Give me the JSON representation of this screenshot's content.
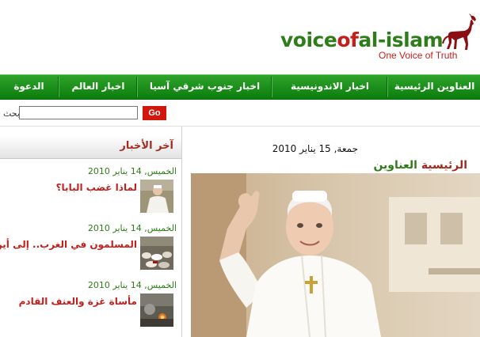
{
  "header": {
    "logo": {
      "part1": "voice",
      "part2": "of",
      "part3": "al-islam"
    },
    "tagline": "One Voice of Truth",
    "logo_icon": "horse-icon"
  },
  "nav": {
    "items": [
      {
        "label": "العناوين الرئيسية"
      },
      {
        "label": "اخبار الاندونيسية"
      },
      {
        "label": "اخبار جنوب شرقي آسيا"
      },
      {
        "label": "اخبار العالم"
      },
      {
        "label": "الدعوة"
      }
    ]
  },
  "search": {
    "label": "بحث",
    "placeholder": "",
    "value": "",
    "button": "Go"
  },
  "sidebar": {
    "title": "آخر الأخبار",
    "items": [
      {
        "date": "الخميس, 14 يناير 2010",
        "title": "لماذا غضب البابا؟",
        "thumb": "pope-thumbnail"
      },
      {
        "date": "الخميس, 14 يناير 2010",
        "title": "المسلمون في الغرب.. إلى أين؟",
        "thumb": "crowd-prayer-thumbnail"
      },
      {
        "date": "الخميس, 14 يناير 2010",
        "title": "مأساة غزة والعنف القادم",
        "thumb": "gaza-thumbnail"
      }
    ]
  },
  "main": {
    "date": "جمعة, 15 يناير 2010",
    "heading": {
      "part1": "العناوين",
      "part2": "الرئيسية"
    },
    "photo": "pope-waving-photo"
  },
  "colors": {
    "green": "#2f7d1a",
    "red": "#c3201c",
    "nav_bg": "#1a8f1b",
    "go_btn": "#d2170f"
  }
}
